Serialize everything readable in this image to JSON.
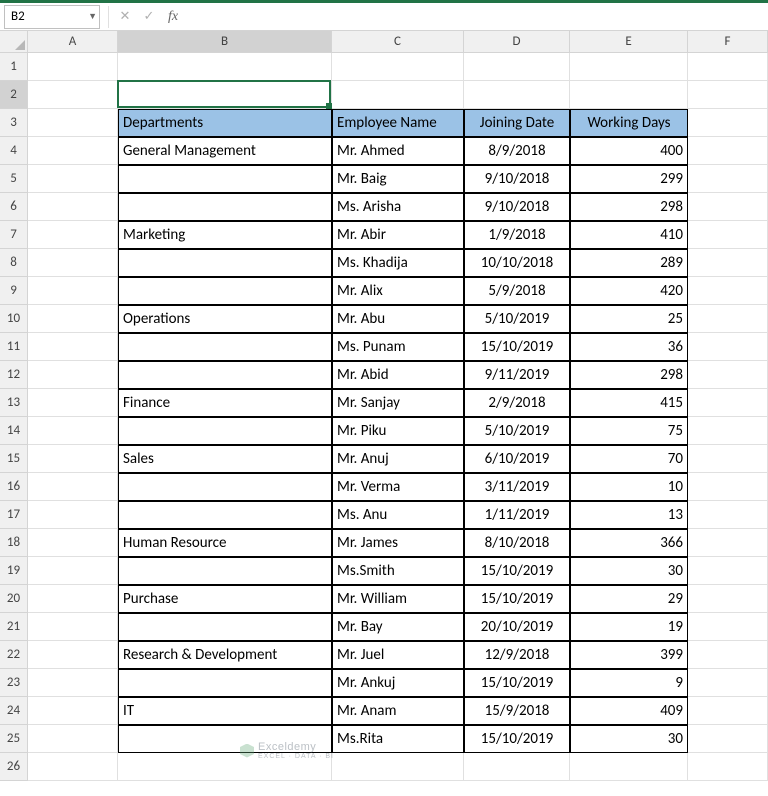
{
  "namebox": "B2",
  "formula": "",
  "columns": [
    "A",
    "B",
    "C",
    "D",
    "E",
    "F"
  ],
  "rowcount": 26,
  "active": {
    "row": 2,
    "col": "B"
  },
  "chart_data": {
    "type": "table",
    "title": "",
    "headers": [
      "Departments",
      "Employee Name",
      "Joining Date",
      "Working Days"
    ],
    "rows": [
      [
        "General Management",
        "Mr. Ahmed",
        "8/9/2018",
        400
      ],
      [
        "",
        "Mr. Baig",
        "9/10/2018",
        299
      ],
      [
        "",
        "Ms. Arisha",
        "9/10/2018",
        298
      ],
      [
        "Marketing",
        "Mr. Abir",
        "1/9/2018",
        410
      ],
      [
        "",
        "Ms. Khadija",
        "10/10/2018",
        289
      ],
      [
        "",
        "Mr. Alix",
        "5/9/2018",
        420
      ],
      [
        "Operations",
        "Mr. Abu",
        "5/10/2019",
        25
      ],
      [
        "",
        "Ms. Punam",
        "15/10/2019",
        36
      ],
      [
        "",
        "Mr. Abid",
        "9/11/2019",
        298
      ],
      [
        "Finance",
        "Mr. Sanjay",
        "2/9/2018",
        415
      ],
      [
        "",
        "Mr. Piku",
        "5/10/2019",
        75
      ],
      [
        "Sales",
        "Mr. Anuj",
        "6/10/2019",
        70
      ],
      [
        "",
        "Mr. Verma",
        "3/11/2019",
        10
      ],
      [
        "",
        "Ms. Anu",
        "1/11/2019",
        13
      ],
      [
        "Human Resource",
        "Mr. James",
        "8/10/2018",
        366
      ],
      [
        "",
        "Ms.Smith",
        "15/10/2019",
        30
      ],
      [
        "Purchase",
        "Mr. William",
        "15/10/2019",
        29
      ],
      [
        "",
        "Mr. Bay",
        "20/10/2019",
        19
      ],
      [
        "Research & Development",
        "Mr. Juel",
        "12/9/2018",
        399
      ],
      [
        "",
        "Mr. Ankuj",
        "15/10/2019",
        9
      ],
      [
        "IT",
        "Mr. Anam",
        "15/9/2018",
        409
      ],
      [
        "",
        "Ms.Rita",
        "15/10/2019",
        30
      ]
    ]
  },
  "watermark": {
    "brand": "Exceldemy",
    "tagline": "EXCEL · DATA · BI"
  }
}
